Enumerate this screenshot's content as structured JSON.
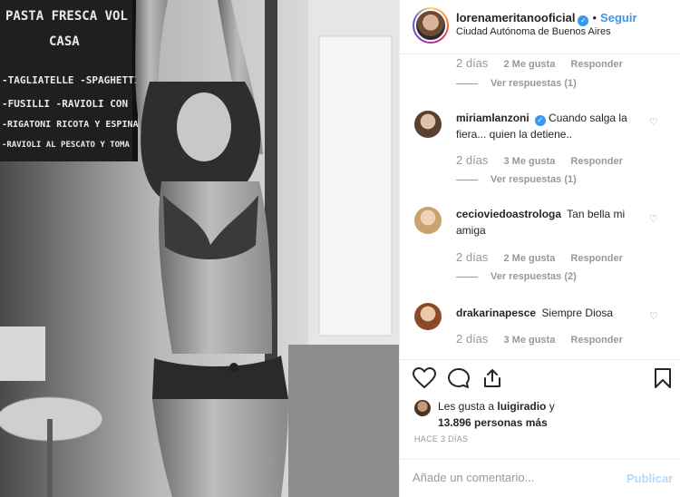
{
  "post": {
    "username": "lorenameritanooficial",
    "follow_label": "Seguir",
    "location": "Ciudad Autónoma de Buenos Aires",
    "photo_chalkboard_lines": [
      "PASTA FRESCA VOL",
      "CASA",
      "-TAGLIATELLE -SPAGHETTI",
      "-FUSILLI   -RAVIOLI CON",
      "-RIGATONI   RICOTA Y ESPINA",
      "-RAVIOLI AL PESCATO Y TOMA"
    ]
  },
  "comments": [
    {
      "username": "",
      "text": "",
      "days": "2 días",
      "likes": "2 Me gusta",
      "reply_label": "Responder",
      "view_replies": "Ver respuestas (1)"
    },
    {
      "username": "miriamlanzoni",
      "verified": true,
      "text": "Cuando salga la fiera... quien la detiene..",
      "days": "2 días",
      "likes": "3 Me gusta",
      "reply_label": "Responder",
      "view_replies": "Ver respuestas (1)"
    },
    {
      "username": "cecioviedoastrologa",
      "text": "Tan bella mi amiga",
      "days": "2 días",
      "likes": "2 Me gusta",
      "reply_label": "Responder",
      "view_replies": "Ver respuestas (2)"
    },
    {
      "username": "drakarinapesce",
      "text": "Siempre Diosa",
      "days": "2 días",
      "likes": "3 Me gusta",
      "reply_label": "Responder"
    }
  ],
  "engagement": {
    "likes_prefix": "Les gusta a",
    "liked_by": "luigiradio",
    "likes_and": "y",
    "likes_count": "13.896 personas más",
    "time_ago": "HACE 3 DÍAS"
  },
  "add_comment": {
    "placeholder": "Añade un comentario...",
    "publish_label": "Publicar"
  },
  "colors": {
    "link_blue": "#3897f0",
    "muted_text": "#999999",
    "publish_disabled": "#b3dbff"
  },
  "icons": [
    "heart-icon",
    "comment-icon",
    "share-icon",
    "bookmark-icon",
    "verified-badge-icon",
    "small-heart-icon"
  ]
}
